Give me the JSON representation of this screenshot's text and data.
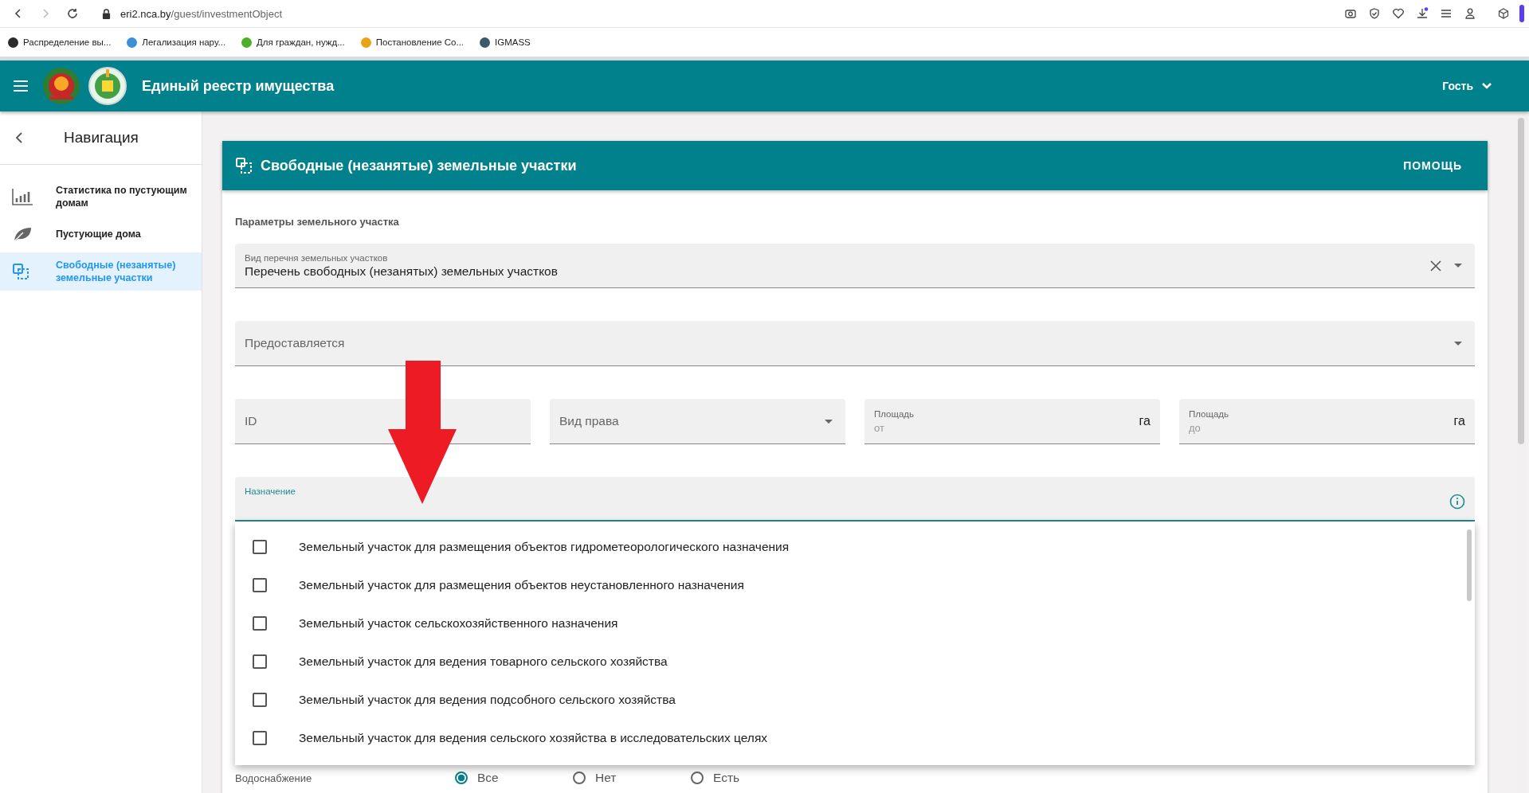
{
  "browser": {
    "url_host": "eri2.nca.by",
    "url_path": "/guest/investmentObject",
    "bookmarks": [
      {
        "label": "Распределение вы...",
        "color": "#2b2b2b"
      },
      {
        "label": "Легализация нару...",
        "color": "#3d8fd6"
      },
      {
        "label": "Для граждан, нужд...",
        "color": "#4caf2a"
      },
      {
        "label": "Постановление Со...",
        "color": "#e8a317"
      },
      {
        "label": "IGMASS",
        "color": "#3a5a6e"
      }
    ]
  },
  "header": {
    "title": "Единый реестр имущества",
    "user": "Гость"
  },
  "sidebar": {
    "title": "Навигация",
    "items": [
      {
        "kind": "chart",
        "label": "Статистика по пустующим домам",
        "selected": false
      },
      {
        "kind": "leaf",
        "label": "Пустующие дома",
        "selected": false
      },
      {
        "kind": "select",
        "label": "Свободные (незанятые) земельные участки",
        "selected": true
      }
    ]
  },
  "card": {
    "title": "Свободные (незанятые) земельные участки",
    "help": "ПОМОЩЬ",
    "section_label": "Параметры земельного участка",
    "list_type": {
      "label": "Вид перечня земельных участков",
      "value": "Перечень свободных (незанятых) земельных участков"
    },
    "provided": {
      "placeholder": "Предоставляется"
    },
    "id_field": {
      "placeholder": "ID"
    },
    "right_type": {
      "placeholder": "Вид права"
    },
    "areas": [
      {
        "label": "Площадь",
        "placeholder": "от",
        "unit": "га"
      },
      {
        "label": "Площадь",
        "placeholder": "до",
        "unit": "га"
      }
    ],
    "purpose": {
      "label": "Назначение",
      "options": [
        {
          "label": "Земельный участок для размещения объектов гидрометеорологического назначения",
          "checked": false
        },
        {
          "label": "Земельный участок для размещения объектов неустановленного назначения",
          "checked": false
        },
        {
          "label": "Земельный участок сельскохозяйственного назначения",
          "checked": false
        },
        {
          "label": "Земельный участок для ведения товарного сельского хозяйства",
          "checked": false
        },
        {
          "label": "Земельный участок для ведения подсобного сельского хозяйства",
          "checked": false
        },
        {
          "label": "Земельный участок для ведения сельского хозяйства в исследовательских целях",
          "checked": false
        }
      ]
    },
    "water": {
      "label": "Водоснабжение",
      "options": [
        {
          "label": "Все",
          "selected": true
        },
        {
          "label": "Нет",
          "selected": false
        },
        {
          "label": "Есть",
          "selected": false
        }
      ]
    }
  }
}
